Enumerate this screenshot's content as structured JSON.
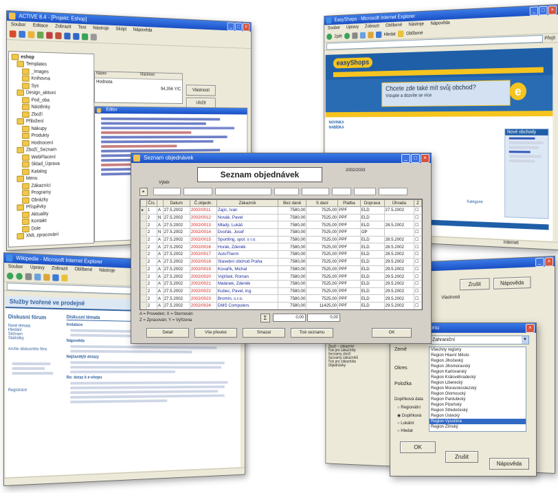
{
  "colors": {
    "xp_title": "#1a4fc4",
    "web_header": "#1f5fa8",
    "web_yellow": "#f6c41e",
    "order_date_red": "#d22222",
    "customer_blue": "#1b2a9a",
    "forum_blue": "#2f5f9e"
  },
  "editor_window": {
    "title": "ACTIVE 8.4 - [Projekt: Eshop]",
    "menu": [
      "Soubor",
      "Editace",
      "Zobrazit",
      "Text",
      "Nástroje",
      "Skript",
      "Nápověda"
    ],
    "tree_root": "eshop",
    "tree_items": [
      "Templates",
      "_Images",
      "Knihovna",
      "Sys",
      "Design_aktivní",
      "Pod_oba",
      "Nástěnky",
      "Zboží",
      "Přiložení",
      "Nákupy",
      "Produkty",
      "Hodnocení",
      "Zboží_Seznam",
      "WebPlacení",
      "Sklad_Úprava",
      "Katalog",
      "Menu",
      "Zákazníci",
      "Programy",
      "Obrázky",
      "Příspěvky",
      "Aktuality",
      "Kontakt",
      "Dole",
      "XML zpracování"
    ],
    "panel_title": "Editor",
    "prop_name_col": "Název",
    "prop_value_col": "Vlastnost",
    "prop_value": "Hodnota",
    "prop_number": "94,356 Y/C",
    "side_button": "Vlastnosti",
    "side_button2": "Uložit"
  },
  "browser_top": {
    "title": "EasyShops - Microsoft Internet Explorer",
    "menu": [
      "Soubor",
      "Úpravy",
      "Zobrazit",
      "Oblíbené",
      "Nástroje",
      "Nápověda"
    ],
    "toolbar_buttons": [
      "Zpět",
      "Hledat",
      "Oblíbené"
    ],
    "go_label": "Přejít",
    "logo": "easyShops",
    "banner_text": "Chcete zde také mít svůj obchod?",
    "banner_sub": "Vstupte a dozvíte se více",
    "sidebar_heading": "Nové obchody",
    "box_label": "Kategorie",
    "news_items": [
      "NOVINKA",
      "NABÍDKA"
    ],
    "status_text": "Internet"
  },
  "orders_dialog": {
    "title": "Seznam objednávek",
    "heading": "Seznam objednávek",
    "year": "2002/2003",
    "filter_label": "Výběr",
    "columns": [
      "",
      "Čís.",
      "",
      "Datum",
      "Č.objedn.",
      "Zákazník",
      "Bez daně",
      "S daní",
      "Platba",
      "Doprava",
      "Úhrada",
      "Z"
    ],
    "rows": [
      {
        "num": "1",
        "date": "27.5.2002",
        "order": "2002/0011",
        "customer": "Zajíc, Ivan",
        "net": "7580,00",
        "gross": "7525,00",
        "pay": "PPF",
        "ship": "ELD",
        "paid": "27.5.2002",
        "flag": "A"
      },
      {
        "num": "2",
        "date": "27.5.2002",
        "order": "2002/0012",
        "customer": "Novák, Pavel",
        "net": "7580,00",
        "gross": "7525,00",
        "pay": "PPF",
        "ship": "ELD",
        "paid": "",
        "flag": "N"
      },
      {
        "num": "2",
        "date": "27.5.2002",
        "order": "2002/0013",
        "customer": "Mladý, Lukáš",
        "net": "7580,00",
        "gross": "7525,00",
        "pay": "PPF",
        "ship": "ELD",
        "paid": "28.5.2002",
        "flag": "A"
      },
      {
        "num": "2",
        "date": "27.5.2002",
        "order": "2002/0014",
        "customer": "Dvořák, Josef",
        "net": "7580,00",
        "gross": "7525,00",
        "pay": "PPF",
        "ship": "OP",
        "paid": "",
        "flag": "N"
      },
      {
        "num": "2",
        "date": "27.5.2002",
        "order": "2002/0015",
        "customer": "Sportling, spol. s r.o.",
        "net": "7580,00",
        "gross": "7525,00",
        "pay": "PPF",
        "ship": "ELD",
        "paid": "28.5.2002",
        "flag": "A"
      },
      {
        "num": "2",
        "date": "27.5.2002",
        "order": "2002/0016",
        "customer": "Horák, Zdeněk",
        "net": "7580,00",
        "gross": "7525,00",
        "pay": "PPF",
        "ship": "ELD",
        "paid": "28.5.2002",
        "flag": "A"
      },
      {
        "num": "2",
        "date": "27.5.2002",
        "order": "2002/0017",
        "customer": "AutoTherm",
        "net": "7580,00",
        "gross": "7525,00",
        "pay": "PPF",
        "ship": "ELD",
        "paid": "28.5.2002",
        "flag": "A"
      },
      {
        "num": "2",
        "date": "27.5.2002",
        "order": "2002/0018",
        "customer": "Stavební obchod Praha",
        "net": "7580,00",
        "gross": "7525,00",
        "pay": "PPF",
        "ship": "ELD",
        "paid": "29.5.2002",
        "flag": "A"
      },
      {
        "num": "2",
        "date": "27.5.2002",
        "order": "2002/0019",
        "customer": "Kovařík, Michal",
        "net": "7580,00",
        "gross": "7525,00",
        "pay": "PPF",
        "ship": "ELD",
        "paid": "29.5.2002",
        "flag": "A"
      },
      {
        "num": "2",
        "date": "27.5.2002",
        "order": "2002/0020",
        "customer": "Vojtíšek, Roman",
        "net": "7580,00",
        "gross": "7525,00",
        "pay": "PPF",
        "ship": "ELD",
        "paid": "29.5.2002",
        "flag": "A"
      },
      {
        "num": "2",
        "date": "27.5.2002",
        "order": "2002/0021",
        "customer": "Malánek, Zdeněk",
        "net": "7580,00",
        "gross": "7525,00",
        "pay": "PPF",
        "ship": "ELD",
        "paid": "29.5.2002",
        "flag": "A"
      },
      {
        "num": "2",
        "date": "27.5.2002",
        "order": "2002/0022",
        "customer": "Kubec, Pavel, ing.",
        "net": "7580,00",
        "gross": "7525,00",
        "pay": "PPF",
        "ship": "ELD",
        "paid": "29.5.2002",
        "flag": "A"
      },
      {
        "num": "2",
        "date": "27.5.2002",
        "order": "2002/0023",
        "customer": "Bromín, s.r.o.",
        "net": "7580,00",
        "gross": "7525,00",
        "pay": "PPF",
        "ship": "ELD",
        "paid": "29.5.2002",
        "flag": "A"
      },
      {
        "num": "2",
        "date": "27.5.2002",
        "order": "2002/0024",
        "customer": "DMS Computers",
        "net": "7580,00",
        "gross": "11425,00",
        "pay": "PPF",
        "ship": "ELD",
        "paid": "29.5.2002",
        "flag": "A"
      }
    ],
    "legend_line1": "A = Proveden; X = Stornován",
    "legend_line2": "Z = Zpracován; Y = Vyřízena",
    "sum_symbol": "Σ",
    "sum_net": "0,00",
    "sum_gross": "0,00",
    "buttons": [
      "Detail",
      "Vše převést",
      "Smazat",
      "Tisk seznamu",
      "OK"
    ]
  },
  "forum_window": {
    "title": "Wikipedie - Microsoft Internet Explorer",
    "heading": "Služby tvořené ve prodejně",
    "sidebar_heading": "Diskusní fórum",
    "sidebar_links": [
      "Nové témata",
      "Hledání",
      "Seznam",
      "Statistiky"
    ],
    "sidebar_link2": "Archiv diskusního fóra",
    "sidebar_link3": "Registrace",
    "column_heading": "Diskusní témata",
    "post_titles": [
      "Instalace",
      "Nápověda",
      "Nejčastější dotazy",
      "Re: dotaz k e-shopu"
    ]
  },
  "settings_window": {
    "button1": "Zrušit",
    "button2": "Nápověda",
    "label": "Vlastnosti",
    "tree_items": [
      "Zboží – zboží",
      "Zboží – zákazníci",
      "Tisk pro zákazníky",
      "Seznamy zboží",
      "Seznamy zákazníků",
      "Tisk pro zákazníka",
      "Objednávky"
    ]
  },
  "regions_dialog": {
    "title": "Výběr Regionu",
    "combo_value": "Zahraniční",
    "labels": [
      "Země",
      "Okres",
      "Položka"
    ],
    "list_items": [
      "Všechny regiony",
      "Region Hlavní Město",
      "Region Jihočeský",
      "Region Jihomoravský",
      "Region Karlovarský",
      "Region Královéhradecký",
      "Region Liberecký",
      "Region Moravskoslezský",
      "Region Olomoucký",
      "Region Pardubický",
      "Region Plzeňský",
      "Region Středočeský",
      "Region Ústecký",
      "Region Vysočina",
      "Region Zlínský"
    ],
    "section_label": "Doplňková data",
    "radio_items": [
      "Regionální",
      "Doplňková",
      "Lokální",
      "Hledat"
    ],
    "buttons": [
      "OK",
      "Zrušit",
      "Nápověda"
    ]
  }
}
